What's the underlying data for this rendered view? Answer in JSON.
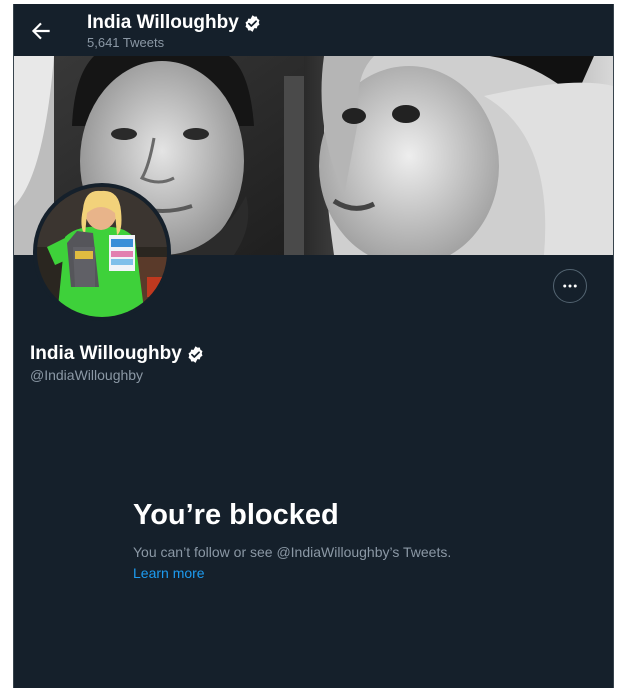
{
  "header": {
    "back_icon": "arrow-left-icon",
    "name": "India Willoughby",
    "verified_icon": "verified-badge-icon",
    "tweet_count": "5,641 Tweets"
  },
  "banner": {
    "description": "black-and-white banner photo"
  },
  "avatar": {
    "description": "profile photo"
  },
  "actions": {
    "more_icon": "more-dots-icon"
  },
  "profile": {
    "name": "India Willoughby",
    "verified_icon": "verified-badge-icon",
    "handle": "@IndiaWilloughby"
  },
  "blocked": {
    "title": "You’re blocked",
    "description": "You can’t follow or see @IndiaWilloughby’s Tweets.",
    "learn_more": "Learn more"
  },
  "colors": {
    "background": "#15202b",
    "secondary_text": "#8b98a5",
    "link": "#1d9bf0",
    "verified_badge": "#ffffff"
  }
}
